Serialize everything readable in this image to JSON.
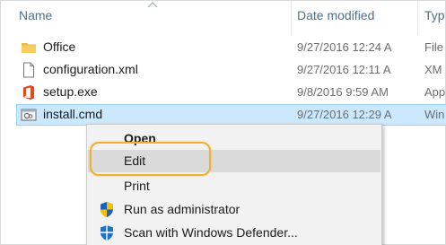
{
  "columns": {
    "name": "Name",
    "date_modified": "Date modified",
    "type": "Typ"
  },
  "files": [
    {
      "name": "Office",
      "date": "9/27/2016 12:24 A",
      "type": "File",
      "icon": "folder-icon",
      "selected": false
    },
    {
      "name": "configuration.xml",
      "date": "9/27/2016 12:11 A",
      "type": "XM",
      "icon": "document-icon",
      "selected": false
    },
    {
      "name": "setup.exe",
      "date": "9/8/2016 9:59 AM",
      "type": "App",
      "icon": "office-app-icon",
      "selected": false
    },
    {
      "name": "install.cmd",
      "date": "9/27/2016 12:29 A",
      "type": "Win",
      "icon": "script-icon",
      "selected": true
    }
  ],
  "context_menu": {
    "items": [
      {
        "label": "Open",
        "bold": true
      },
      {
        "label": "Edit",
        "hover": true,
        "highlighted": true
      },
      {
        "label": "Print"
      },
      {
        "label": "Run as administrator",
        "icon": "uac-shield-icon"
      },
      {
        "label": "Scan with Windows Defender...",
        "icon": "defender-shield-icon"
      }
    ]
  },
  "colors": {
    "selection": "#cce8ff",
    "selection_border": "#99d1ff",
    "menu_background": "#f2f2f2",
    "menu_hover": "#dadada",
    "highlight_ring": "#f0b030",
    "header_text": "#4d6f8c"
  }
}
